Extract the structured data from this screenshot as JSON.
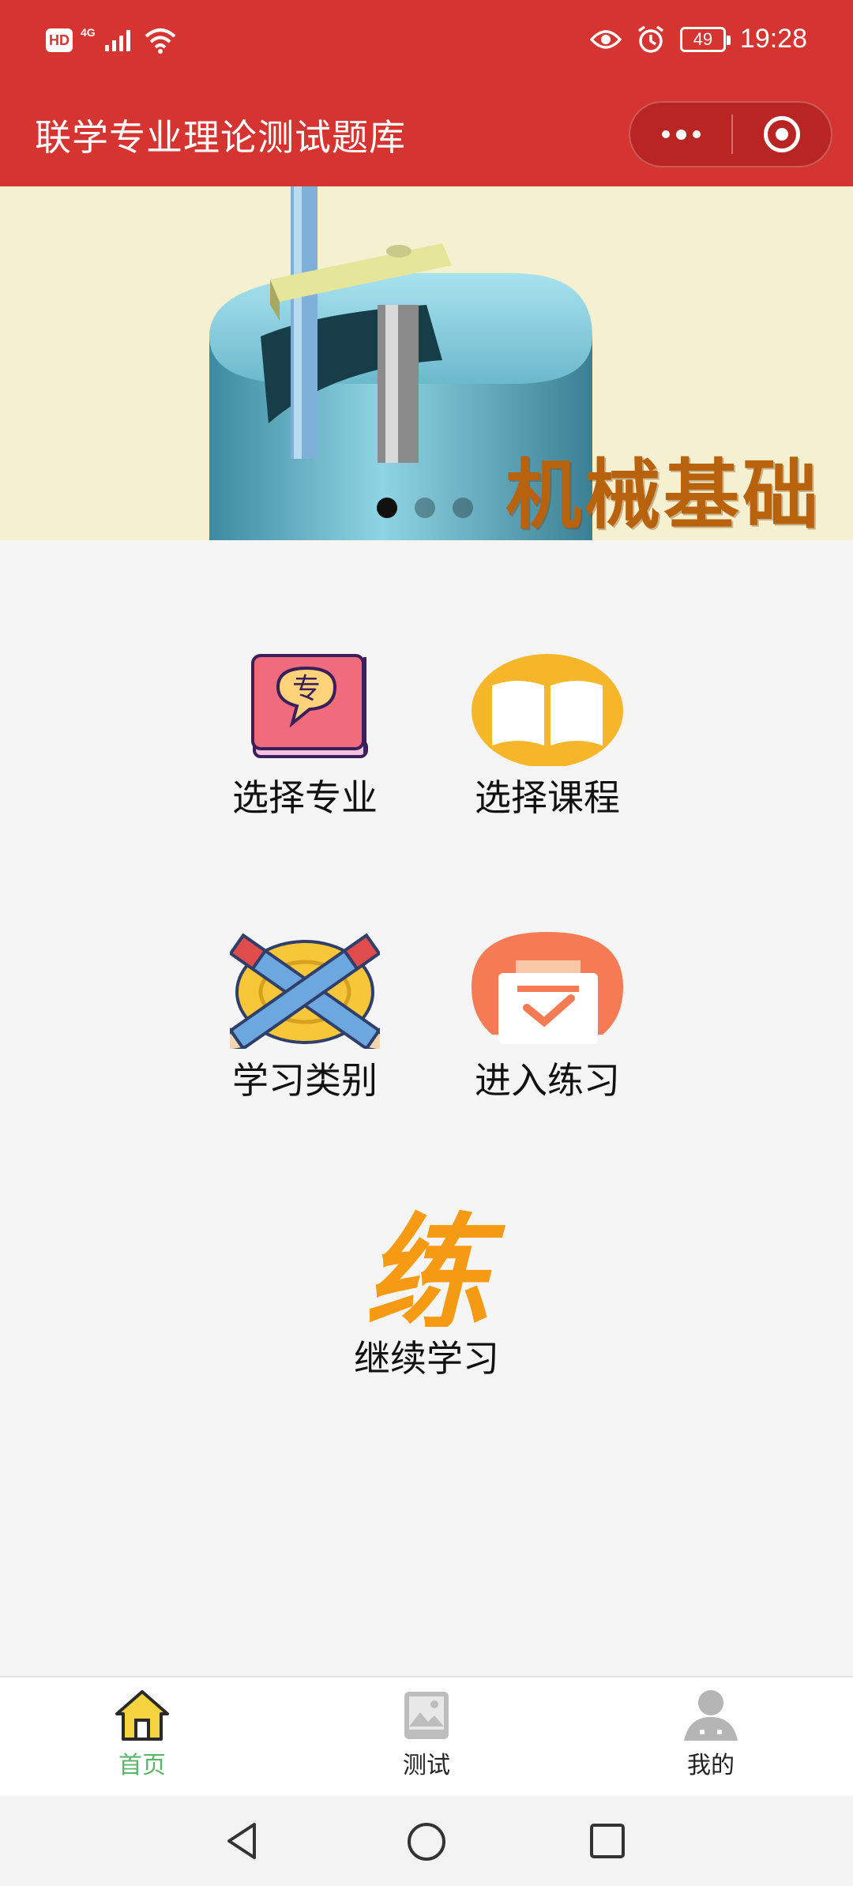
{
  "status_bar": {
    "hd": "HD",
    "network": "4G",
    "battery": "49",
    "time": "19:28"
  },
  "title_bar": {
    "title": "联学专业理论测试题库"
  },
  "banner": {
    "caption": "机械基础",
    "slide_count": 3,
    "active_slide": 1
  },
  "menu": {
    "items": [
      {
        "label": "选择专业",
        "icon": "book-speech-icon",
        "icon_text": "专"
      },
      {
        "label": "选择课程",
        "icon": "open-book-icon"
      },
      {
        "label": "学习类别",
        "icon": "crossed-pencils-icon"
      },
      {
        "label": "进入练习",
        "icon": "checklist-tray-icon"
      },
      {
        "label": "继续学习",
        "icon": "practice-glyph-icon",
        "icon_text": "练"
      }
    ]
  },
  "tabbar": {
    "tabs": [
      {
        "label": "首页",
        "icon": "home-icon",
        "active": true
      },
      {
        "label": "测试",
        "icon": "image-icon",
        "active": false
      },
      {
        "label": "我的",
        "icon": "person-icon",
        "active": false
      }
    ]
  },
  "colors": {
    "header_red": "#d63431",
    "active_tab_green": "#5bb56a",
    "practice_orange": "#f59a12"
  }
}
